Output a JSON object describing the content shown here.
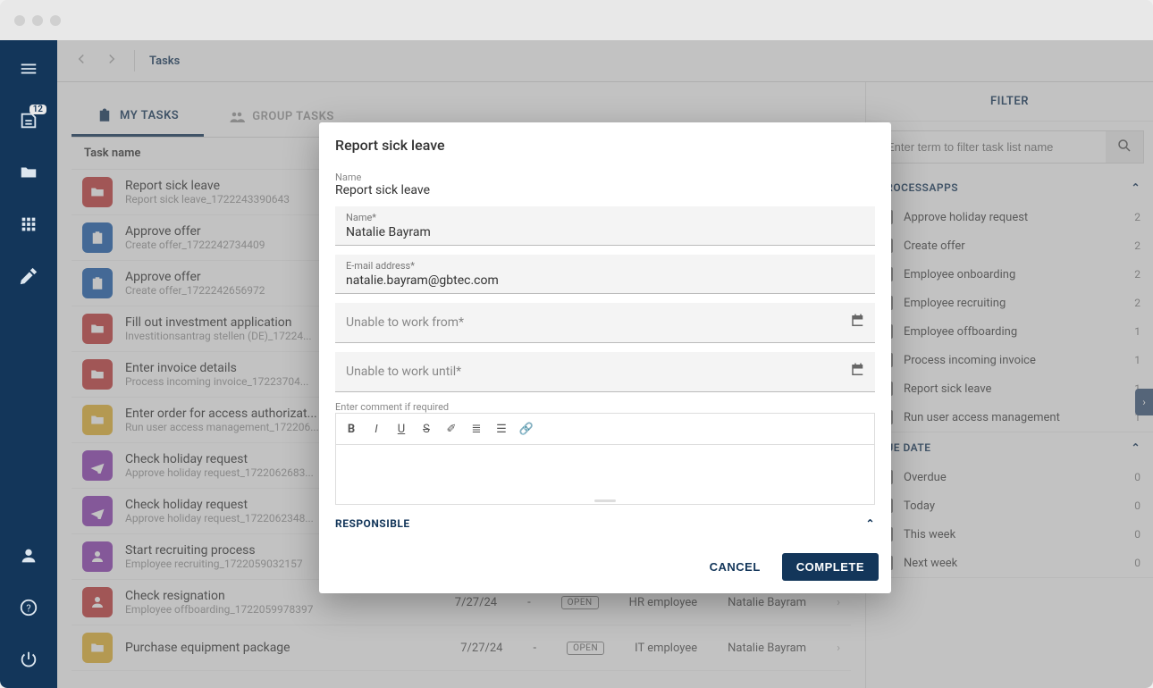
{
  "sidebar": {
    "badge": "12"
  },
  "header": {
    "breadcrumb": "Tasks"
  },
  "tabs": {
    "my": "MY TASKS",
    "group": "GROUP TASKS"
  },
  "column_header": "Task name",
  "tasks": [
    {
      "title": "Report sick leave",
      "sub": "Report sick leave_1722243390643",
      "color": "ic-red",
      "icon": "folder"
    },
    {
      "title": "Approve offer",
      "sub": "Create offer_1722242734409",
      "color": "ic-blue",
      "icon": "clipboard"
    },
    {
      "title": "Approve offer",
      "sub": "Create offer_1722242656972",
      "color": "ic-blue",
      "icon": "clipboard"
    },
    {
      "title": "Fill out investment application",
      "sub": "Investitionsantrag stellen (DE)_17224...",
      "color": "ic-red",
      "icon": "folder"
    },
    {
      "title": "Enter invoice details",
      "sub": "Process incoming invoice_17223704...",
      "color": "ic-red",
      "icon": "folder"
    },
    {
      "title": "Enter order for access authorizat...",
      "sub": "Run user access management_172206...",
      "color": "ic-yellow",
      "icon": "folder"
    },
    {
      "title": "Check holiday request",
      "sub": "Approve holiday request_1722062683...",
      "color": "ic-purple",
      "icon": "plane"
    },
    {
      "title": "Check holiday request",
      "sub": "Approve holiday request_1722062348...",
      "color": "ic-purple",
      "icon": "plane"
    },
    {
      "title": "Start recruiting process",
      "sub": "Employee recruiting_1722059032157",
      "color": "ic-purple",
      "icon": "person"
    },
    {
      "title": "Check resignation",
      "sub": "Employee offboarding_1722059978397",
      "color": "ic-red",
      "icon": "person"
    },
    {
      "title": "Purchase equipment package",
      "sub": "",
      "color": "ic-yellow",
      "icon": "folder"
    }
  ],
  "visible_meta_rows": [
    {
      "date": "7/27/24",
      "dash": "-",
      "status": "OPEN",
      "role": "HR employee",
      "assignee": "Natalie Bayram"
    },
    {
      "date": "7/27/24",
      "dash": "-",
      "status": "OPEN",
      "role": "IT employee",
      "assignee": "Natalie Bayram"
    }
  ],
  "filter": {
    "title": "FILTER",
    "search_ph": "Enter term to filter task list name",
    "sections": {
      "processapps": {
        "label": "PROCESSAPPS",
        "items": [
          {
            "label": "Approve holiday request",
            "count": "2"
          },
          {
            "label": "Create offer",
            "count": "2"
          },
          {
            "label": "Employee onboarding",
            "count": "2"
          },
          {
            "label": "Employee recruiting",
            "count": "2"
          },
          {
            "label": "Employee offboarding",
            "count": "1"
          },
          {
            "label": "Process incoming invoice",
            "count": "1"
          },
          {
            "label": "Report sick leave",
            "count": "1"
          },
          {
            "label": "Run user access management",
            "count": "1"
          }
        ]
      },
      "duedate": {
        "label": "DUE DATE",
        "items": [
          {
            "label": "Overdue",
            "count": "0"
          },
          {
            "label": "Today",
            "count": "0"
          },
          {
            "label": "This week",
            "count": "0"
          },
          {
            "label": "Next week",
            "count": "0"
          }
        ]
      }
    }
  },
  "modal": {
    "title": "Report sick leave",
    "ro_name_lbl": "Name",
    "ro_name_val": "Report sick leave",
    "name_lbl": "Name*",
    "name_val": "Natalie Bayram",
    "email_lbl": "E-mail address*",
    "email_val": "natalie.bayram@gbtec.com",
    "from_lbl": "Unable to work from*",
    "until_lbl": "Unable to work until*",
    "comment_lbl": "Enter comment if required",
    "responsible": "RESPONSIBLE",
    "cancel": "CANCEL",
    "complete": "COMPLETE"
  }
}
